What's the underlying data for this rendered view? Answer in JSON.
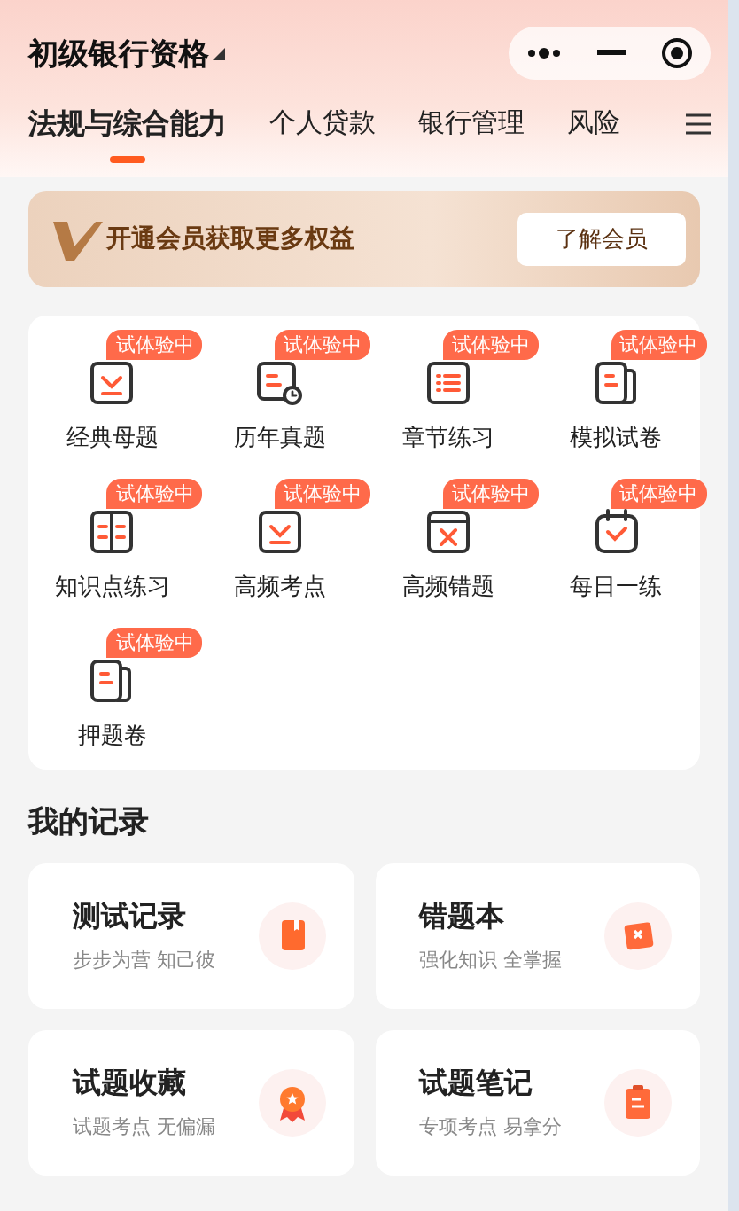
{
  "header": {
    "title": "初级银行资格"
  },
  "tabs": [
    {
      "label": "法规与综合能力",
      "selected": true
    },
    {
      "label": "个人贷款",
      "selected": false
    },
    {
      "label": "银行管理",
      "selected": false
    },
    {
      "label": "风险",
      "selected": false
    }
  ],
  "banner": {
    "text": "开通会员获取更多权益",
    "button": "了解会员"
  },
  "tools": [
    {
      "label": "经典母题",
      "badge": "试体验中"
    },
    {
      "label": "历年真题",
      "badge": "试体验中"
    },
    {
      "label": "章节练习",
      "badge": "试体验中"
    },
    {
      "label": "模拟试卷",
      "badge": "试体验中"
    },
    {
      "label": "知识点练习",
      "badge": "试体验中"
    },
    {
      "label": "高频考点",
      "badge": "试体验中"
    },
    {
      "label": "高频错题",
      "badge": "试体验中"
    },
    {
      "label": "每日一练",
      "badge": "试体验中"
    },
    {
      "label": "押题卷",
      "badge": "试体验中"
    }
  ],
  "records": {
    "title": "我的记录",
    "items": [
      {
        "title": "测试记录",
        "subtitle": "步步为营 知己彼"
      },
      {
        "title": "错题本",
        "subtitle": "强化知识 全掌握"
      },
      {
        "title": "试题收藏",
        "subtitle": "试题考点 无偏漏"
      },
      {
        "title": "试题笔记",
        "subtitle": "专项考点 易拿分"
      }
    ]
  }
}
